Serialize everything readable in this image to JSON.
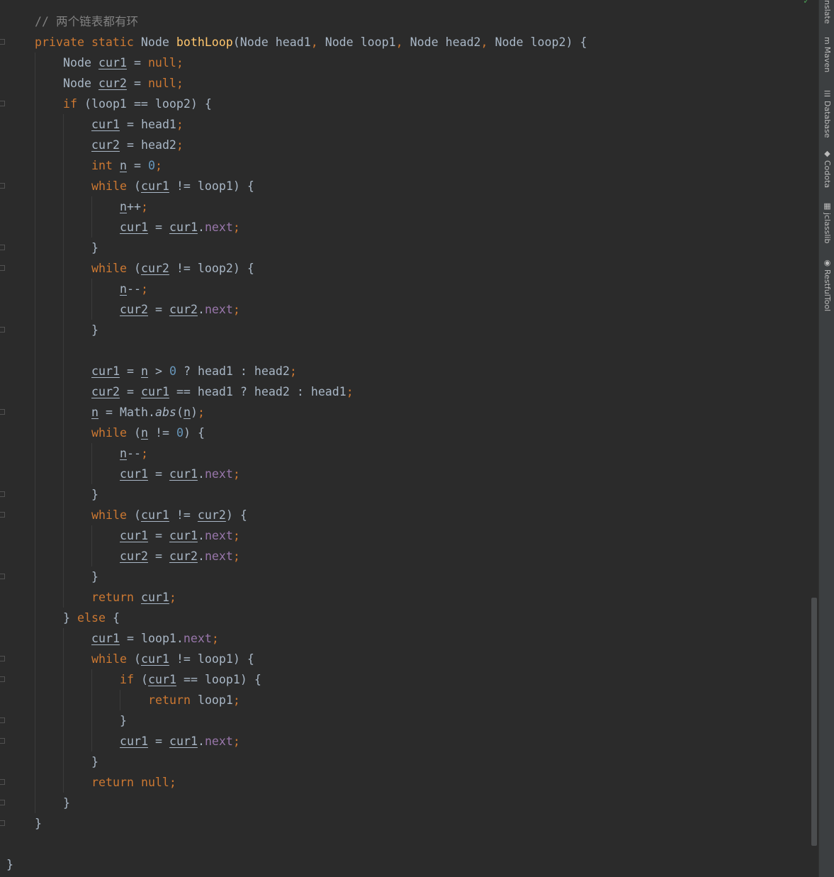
{
  "sidebar": {
    "tools": [
      {
        "label": "nslate",
        "icon": ""
      },
      {
        "label": "Maven",
        "icon": "m"
      },
      {
        "label": "Database",
        "icon": "☰"
      },
      {
        "label": "Codota",
        "icon": "◆"
      },
      {
        "label": "jclasslib",
        "icon": "▦"
      },
      {
        "label": "RestfulTool",
        "icon": "◉"
      }
    ]
  },
  "editor": {
    "status_icon": "✓",
    "lines": [
      {
        "indent": 1,
        "tokens": [
          [
            "cm",
            "// 两个链表都有环"
          ]
        ]
      },
      {
        "indent": 1,
        "tokens": [
          [
            "kw",
            "private"
          ],
          [
            "sp",
            ""
          ],
          [
            "kw",
            "static"
          ],
          [
            "sp",
            ""
          ],
          [
            "t",
            "Node"
          ],
          [
            "sp",
            ""
          ],
          [
            "fn",
            "bothLoop"
          ],
          [
            "t",
            "(Node"
          ],
          [
            "sp",
            ""
          ],
          [
            "t",
            "head1"
          ],
          [
            "kw",
            ","
          ],
          [
            "sp",
            ""
          ],
          [
            "t",
            "Node"
          ],
          [
            "sp",
            ""
          ],
          [
            "t",
            "loop1"
          ],
          [
            "kw",
            ","
          ],
          [
            "sp",
            ""
          ],
          [
            "t",
            "Node"
          ],
          [
            "sp",
            ""
          ],
          [
            "t",
            "head2"
          ],
          [
            "kw",
            ","
          ],
          [
            "sp",
            ""
          ],
          [
            "t",
            "Node"
          ],
          [
            "sp",
            ""
          ],
          [
            "t",
            "loop2)"
          ],
          [
            "sp",
            ""
          ],
          [
            "t",
            "{"
          ]
        ]
      },
      {
        "indent": 2,
        "tokens": [
          [
            "t",
            "Node"
          ],
          [
            "sp",
            ""
          ],
          [
            "lv",
            "cur1"
          ],
          [
            "sp",
            ""
          ],
          [
            "t",
            "="
          ],
          [
            "sp",
            ""
          ],
          [
            "kw",
            "null;"
          ]
        ]
      },
      {
        "indent": 2,
        "tokens": [
          [
            "t",
            "Node"
          ],
          [
            "sp",
            ""
          ],
          [
            "lv",
            "cur2"
          ],
          [
            "sp",
            ""
          ],
          [
            "t",
            "="
          ],
          [
            "sp",
            ""
          ],
          [
            "kw",
            "null;"
          ]
        ]
      },
      {
        "indent": 2,
        "tokens": [
          [
            "kw",
            "if"
          ],
          [
            "sp",
            ""
          ],
          [
            "t",
            "(loop1"
          ],
          [
            "sp",
            ""
          ],
          [
            "t",
            "=="
          ],
          [
            "sp",
            ""
          ],
          [
            "t",
            "loop2)"
          ],
          [
            "sp",
            ""
          ],
          [
            "t",
            "{"
          ]
        ]
      },
      {
        "indent": 3,
        "tokens": [
          [
            "lv",
            "cur1"
          ],
          [
            "sp",
            ""
          ],
          [
            "t",
            "="
          ],
          [
            "sp",
            ""
          ],
          [
            "t",
            "head1"
          ],
          [
            "kw",
            ";"
          ]
        ]
      },
      {
        "indent": 3,
        "tokens": [
          [
            "lv",
            "cur2"
          ],
          [
            "sp",
            ""
          ],
          [
            "t",
            "="
          ],
          [
            "sp",
            ""
          ],
          [
            "t",
            "head2"
          ],
          [
            "kw",
            ";"
          ]
        ]
      },
      {
        "indent": 3,
        "tokens": [
          [
            "kw",
            "int"
          ],
          [
            "sp",
            ""
          ],
          [
            "lv",
            "n"
          ],
          [
            "sp",
            ""
          ],
          [
            "t",
            "="
          ],
          [
            "sp",
            ""
          ],
          [
            "num",
            "0"
          ],
          [
            "kw",
            ";"
          ]
        ]
      },
      {
        "indent": 3,
        "tokens": [
          [
            "kw",
            "while"
          ],
          [
            "sp",
            ""
          ],
          [
            "t",
            "("
          ],
          [
            "lv",
            "cur1"
          ],
          [
            "sp",
            ""
          ],
          [
            "t",
            "!="
          ],
          [
            "sp",
            ""
          ],
          [
            "t",
            "loop1)"
          ],
          [
            "sp",
            ""
          ],
          [
            "t",
            "{"
          ]
        ]
      },
      {
        "indent": 4,
        "tokens": [
          [
            "lv",
            "n"
          ],
          [
            "t",
            "++"
          ],
          [
            "kw",
            ";"
          ]
        ]
      },
      {
        "indent": 4,
        "tokens": [
          [
            "lv",
            "cur1"
          ],
          [
            "sp",
            ""
          ],
          [
            "t",
            "="
          ],
          [
            "sp",
            ""
          ],
          [
            "lv",
            "cur1"
          ],
          [
            "t",
            "."
          ],
          [
            "fld",
            "next"
          ],
          [
            "kw",
            ";"
          ]
        ]
      },
      {
        "indent": 3,
        "tokens": [
          [
            "t",
            "}"
          ]
        ]
      },
      {
        "indent": 3,
        "tokens": [
          [
            "kw",
            "while"
          ],
          [
            "sp",
            ""
          ],
          [
            "t",
            "("
          ],
          [
            "lv",
            "cur2"
          ],
          [
            "sp",
            ""
          ],
          [
            "t",
            "!="
          ],
          [
            "sp",
            ""
          ],
          [
            "t",
            "loop2)"
          ],
          [
            "sp",
            ""
          ],
          [
            "t",
            "{"
          ]
        ]
      },
      {
        "indent": 4,
        "tokens": [
          [
            "lv",
            "n"
          ],
          [
            "t",
            "--"
          ],
          [
            "kw",
            ";"
          ]
        ]
      },
      {
        "indent": 4,
        "tokens": [
          [
            "lv",
            "cur2"
          ],
          [
            "sp",
            ""
          ],
          [
            "t",
            "="
          ],
          [
            "sp",
            ""
          ],
          [
            "lv",
            "cur2"
          ],
          [
            "t",
            "."
          ],
          [
            "fld",
            "next"
          ],
          [
            "kw",
            ";"
          ]
        ]
      },
      {
        "indent": 3,
        "tokens": [
          [
            "t",
            "}"
          ]
        ]
      },
      {
        "indent": 3,
        "tokens": []
      },
      {
        "indent": 3,
        "tokens": [
          [
            "lv",
            "cur1"
          ],
          [
            "sp",
            ""
          ],
          [
            "t",
            "="
          ],
          [
            "sp",
            ""
          ],
          [
            "lv",
            "n"
          ],
          [
            "sp",
            ""
          ],
          [
            "t",
            ">"
          ],
          [
            "sp",
            ""
          ],
          [
            "num",
            "0"
          ],
          [
            "sp",
            ""
          ],
          [
            "t",
            "?"
          ],
          [
            "sp",
            ""
          ],
          [
            "t",
            "head1"
          ],
          [
            "sp",
            ""
          ],
          [
            "t",
            ":"
          ],
          [
            "sp",
            ""
          ],
          [
            "t",
            "head2"
          ],
          [
            "kw",
            ";"
          ]
        ]
      },
      {
        "indent": 3,
        "tokens": [
          [
            "lv",
            "cur2"
          ],
          [
            "sp",
            ""
          ],
          [
            "t",
            "="
          ],
          [
            "sp",
            ""
          ],
          [
            "lv",
            "cur1"
          ],
          [
            "sp",
            ""
          ],
          [
            "t",
            "=="
          ],
          [
            "sp",
            ""
          ],
          [
            "t",
            "head1"
          ],
          [
            "sp",
            ""
          ],
          [
            "t",
            "?"
          ],
          [
            "sp",
            ""
          ],
          [
            "t",
            "head2"
          ],
          [
            "sp",
            ""
          ],
          [
            "t",
            ":"
          ],
          [
            "sp",
            ""
          ],
          [
            "t",
            "head1"
          ],
          [
            "kw",
            ";"
          ]
        ]
      },
      {
        "indent": 3,
        "tokens": [
          [
            "lv",
            "n"
          ],
          [
            "sp",
            ""
          ],
          [
            "t",
            "="
          ],
          [
            "sp",
            ""
          ],
          [
            "t",
            "Math."
          ],
          [
            "it",
            "abs"
          ],
          [
            "t",
            "("
          ],
          [
            "lv",
            "n"
          ],
          [
            "t",
            ")"
          ],
          [
            "kw",
            ";"
          ]
        ]
      },
      {
        "indent": 3,
        "tokens": [
          [
            "kw",
            "while"
          ],
          [
            "sp",
            ""
          ],
          [
            "t",
            "("
          ],
          [
            "lv",
            "n"
          ],
          [
            "sp",
            ""
          ],
          [
            "t",
            "!="
          ],
          [
            "sp",
            ""
          ],
          [
            "num",
            "0"
          ],
          [
            "t",
            ")"
          ],
          [
            "sp",
            ""
          ],
          [
            "t",
            "{"
          ]
        ]
      },
      {
        "indent": 4,
        "tokens": [
          [
            "lv",
            "n"
          ],
          [
            "t",
            "--"
          ],
          [
            "kw",
            ";"
          ]
        ]
      },
      {
        "indent": 4,
        "tokens": [
          [
            "lv",
            "cur1"
          ],
          [
            "sp",
            ""
          ],
          [
            "t",
            "="
          ],
          [
            "sp",
            ""
          ],
          [
            "lv",
            "cur1"
          ],
          [
            "t",
            "."
          ],
          [
            "fld",
            "next"
          ],
          [
            "kw",
            ";"
          ]
        ]
      },
      {
        "indent": 3,
        "tokens": [
          [
            "t",
            "}"
          ]
        ]
      },
      {
        "indent": 3,
        "tokens": [
          [
            "kw",
            "while"
          ],
          [
            "sp",
            ""
          ],
          [
            "t",
            "("
          ],
          [
            "lv",
            "cur1"
          ],
          [
            "sp",
            ""
          ],
          [
            "t",
            "!="
          ],
          [
            "sp",
            ""
          ],
          [
            "lv",
            "cur2"
          ],
          [
            "t",
            ")"
          ],
          [
            "sp",
            ""
          ],
          [
            "t",
            "{"
          ]
        ]
      },
      {
        "indent": 4,
        "tokens": [
          [
            "lv",
            "cur1"
          ],
          [
            "sp",
            ""
          ],
          [
            "t",
            "="
          ],
          [
            "sp",
            ""
          ],
          [
            "lv",
            "cur1"
          ],
          [
            "t",
            "."
          ],
          [
            "fld",
            "next"
          ],
          [
            "kw",
            ";"
          ]
        ]
      },
      {
        "indent": 4,
        "tokens": [
          [
            "lv",
            "cur2"
          ],
          [
            "sp",
            ""
          ],
          [
            "t",
            "="
          ],
          [
            "sp",
            ""
          ],
          [
            "lv",
            "cur2"
          ],
          [
            "t",
            "."
          ],
          [
            "fld",
            "next"
          ],
          [
            "kw",
            ";"
          ]
        ]
      },
      {
        "indent": 3,
        "tokens": [
          [
            "t",
            "}"
          ]
        ]
      },
      {
        "indent": 3,
        "tokens": [
          [
            "kw",
            "return"
          ],
          [
            "sp",
            ""
          ],
          [
            "lv",
            "cur1"
          ],
          [
            "kw",
            ";"
          ]
        ]
      },
      {
        "indent": 2,
        "tokens": [
          [
            "t",
            "}"
          ],
          [
            "sp",
            ""
          ],
          [
            "kw",
            "else"
          ],
          [
            "sp",
            ""
          ],
          [
            "t",
            "{"
          ]
        ]
      },
      {
        "indent": 3,
        "tokens": [
          [
            "lv",
            "cur1"
          ],
          [
            "sp",
            ""
          ],
          [
            "t",
            "="
          ],
          [
            "sp",
            ""
          ],
          [
            "t",
            "loop1."
          ],
          [
            "fld",
            "next"
          ],
          [
            "kw",
            ";"
          ]
        ]
      },
      {
        "indent": 3,
        "tokens": [
          [
            "kw",
            "while"
          ],
          [
            "sp",
            ""
          ],
          [
            "t",
            "("
          ],
          [
            "lv",
            "cur1"
          ],
          [
            "sp",
            ""
          ],
          [
            "t",
            "!="
          ],
          [
            "sp",
            ""
          ],
          [
            "t",
            "loop1)"
          ],
          [
            "sp",
            ""
          ],
          [
            "t",
            "{"
          ]
        ]
      },
      {
        "indent": 4,
        "tokens": [
          [
            "kw",
            "if"
          ],
          [
            "sp",
            ""
          ],
          [
            "t",
            "("
          ],
          [
            "lv",
            "cur1"
          ],
          [
            "sp",
            ""
          ],
          [
            "t",
            "=="
          ],
          [
            "sp",
            ""
          ],
          [
            "t",
            "loop1)"
          ],
          [
            "sp",
            ""
          ],
          [
            "t",
            "{"
          ]
        ]
      },
      {
        "indent": 5,
        "tokens": [
          [
            "kw",
            "return"
          ],
          [
            "sp",
            ""
          ],
          [
            "t",
            "loop1"
          ],
          [
            "kw",
            ";"
          ]
        ]
      },
      {
        "indent": 4,
        "tokens": [
          [
            "t",
            "}"
          ]
        ]
      },
      {
        "indent": 4,
        "tokens": [
          [
            "lv",
            "cur1"
          ],
          [
            "sp",
            ""
          ],
          [
            "t",
            "="
          ],
          [
            "sp",
            ""
          ],
          [
            "lv",
            "cur1"
          ],
          [
            "t",
            "."
          ],
          [
            "fld",
            "next"
          ],
          [
            "kw",
            ";"
          ]
        ]
      },
      {
        "indent": 3,
        "tokens": [
          [
            "t",
            "}"
          ]
        ]
      },
      {
        "indent": 3,
        "tokens": [
          [
            "kw",
            "return"
          ],
          [
            "sp",
            ""
          ],
          [
            "kw",
            "null;"
          ]
        ]
      },
      {
        "indent": 2,
        "tokens": [
          [
            "t",
            "}"
          ]
        ]
      },
      {
        "indent": 1,
        "tokens": [
          [
            "t",
            "}"
          ]
        ]
      },
      {
        "indent": 0,
        "tokens": []
      },
      {
        "indent": 0,
        "tokens": [
          [
            "t",
            "}"
          ]
        ]
      }
    ]
  }
}
